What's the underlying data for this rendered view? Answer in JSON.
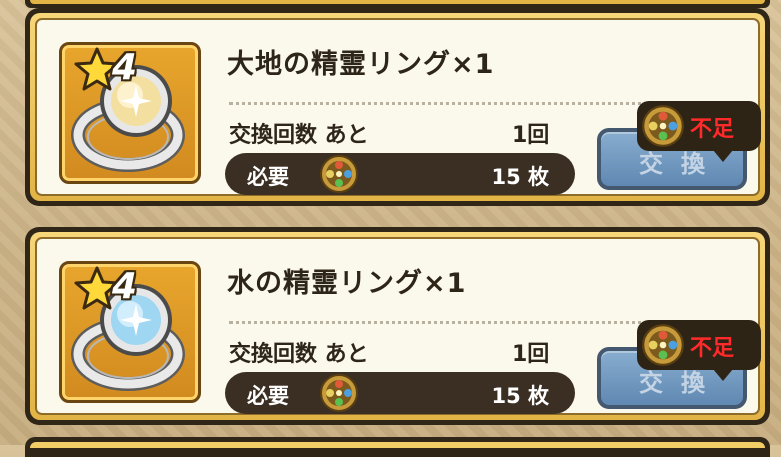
{
  "items": [
    {
      "stars": "4",
      "name": "大地の精霊リング×1",
      "count_label": "交換回数 あと",
      "count_value": "1回",
      "required_label": "必要",
      "required_qty": "15 枚",
      "button_label": "交換",
      "shortage_label": "不足",
      "gem_color": "#f3dfa0",
      "icon": "earth-spirit-ring-icon"
    },
    {
      "stars": "4",
      "name": "水の精霊リング×1",
      "count_label": "交換回数 あと",
      "count_value": "1回",
      "required_label": "必要",
      "required_qty": "15 枚",
      "button_label": "交換",
      "shortage_label": "不足",
      "gem_color": "#9fd6f2",
      "icon": "water-spirit-ring-icon"
    }
  ],
  "colors": {
    "card_gold": "#e2b446",
    "button_blue": "#3e70a6",
    "shortage_red": "#ff2a2a"
  }
}
